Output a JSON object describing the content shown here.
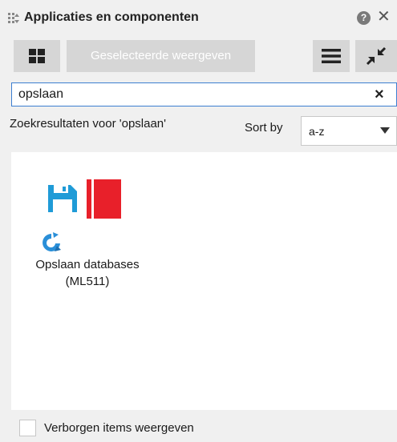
{
  "panel": {
    "title": "Applicaties en componenten",
    "help_icon": "?",
    "close_icon": "close-icon"
  },
  "toolbar": {
    "tile_view_icon": "grid-icon",
    "selected_button_label": "Geselecteerde weergeven",
    "list_view_icon": "list-icon",
    "collapse_icon": "collapse-icon"
  },
  "search": {
    "value": "opslaan",
    "clear_icon": "×"
  },
  "results": {
    "heading": "Zoekresultaten voor 'opslaan'",
    "sort_label": "Sort by",
    "sort_value": "a-z",
    "items": [
      {
        "name_line1": "Opslaan databases",
        "name_line2": "(ML511)",
        "icons": [
          "floppy-disk-icon",
          "red-book-icon",
          "swirl-logo-icon"
        ]
      }
    ]
  },
  "footer": {
    "checkbox_checked": false,
    "label": "Verborgen items weergeven"
  },
  "colors": {
    "accent": "#3d7fd1",
    "button_bg": "#d6d6d6",
    "floppy": "#1f9bd7",
    "book": "#e8202a",
    "swirl": "#2a8fd8"
  }
}
